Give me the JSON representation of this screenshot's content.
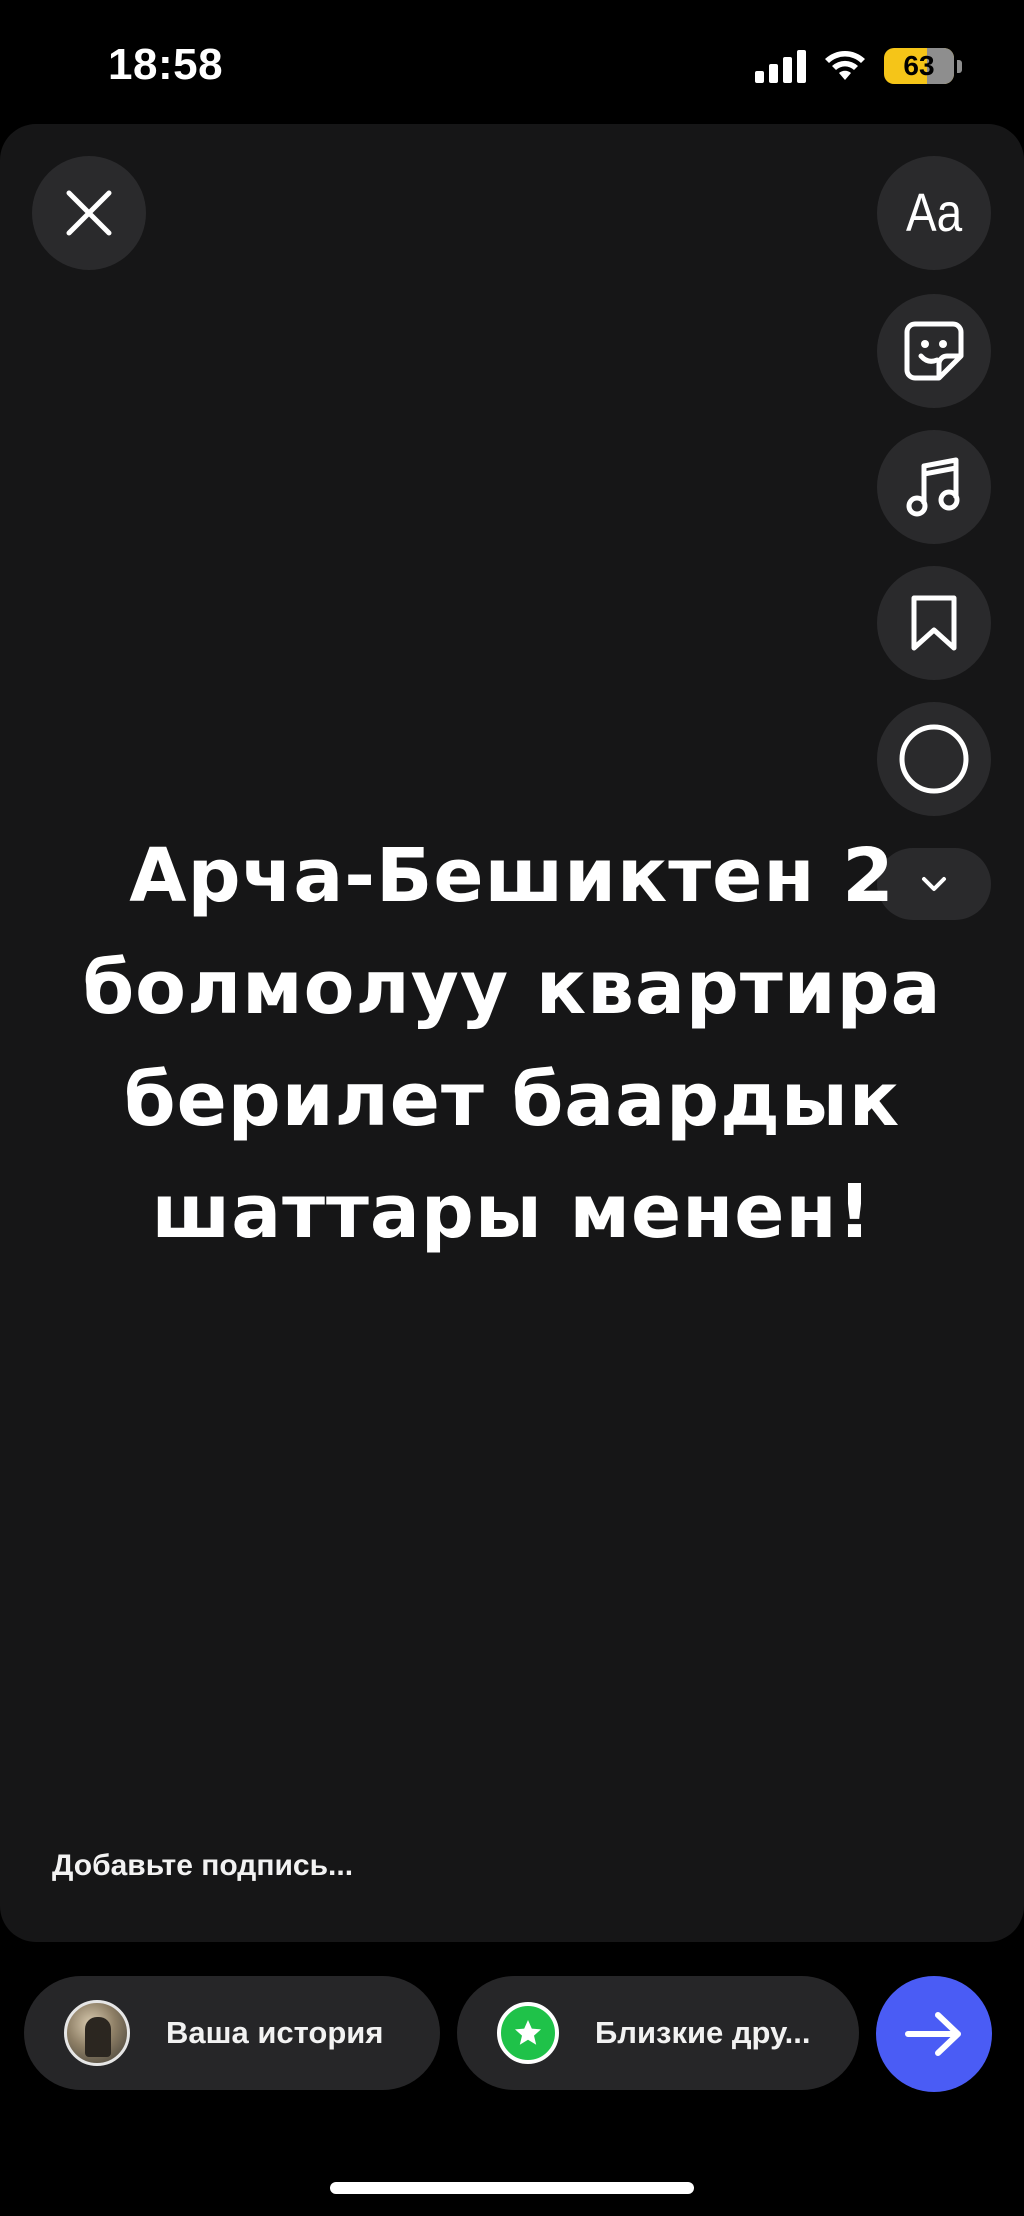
{
  "status_bar": {
    "time": "18:58",
    "battery": "63",
    "icons": [
      "cellular-signal-icon",
      "wifi-icon",
      "battery-icon"
    ]
  },
  "editor": {
    "close_icon": "close-icon",
    "tools": [
      {
        "name": "text-tool",
        "label": "Aa",
        "icon": "text-icon"
      },
      {
        "name": "sticker-tool",
        "icon": "sticker-icon"
      },
      {
        "name": "music-tool",
        "icon": "music-note-icon"
      },
      {
        "name": "save-tool",
        "icon": "bookmark-icon"
      },
      {
        "name": "effects-tool",
        "icon": "circle-icon"
      },
      {
        "name": "more-tools",
        "icon": "chevron-down-icon"
      }
    ],
    "story_text_lines": [
      "Арча-Бешиктен 2",
      "болмолуу квартира",
      "берилет баардык",
      "шаттары менен!"
    ],
    "caption_placeholder": "Добавьте подпись..."
  },
  "share_bar": {
    "your_story_label": "Ваша история",
    "close_friends_label": "Близкие дру...",
    "send_icon": "arrow-right-icon"
  },
  "colors": {
    "canvas_bg": "#161617",
    "button_bg": "#2a2a2c",
    "send_button": "#4a5cf5",
    "close_friends_green": "#1fc249",
    "battery_yellow": "#f5c518"
  }
}
